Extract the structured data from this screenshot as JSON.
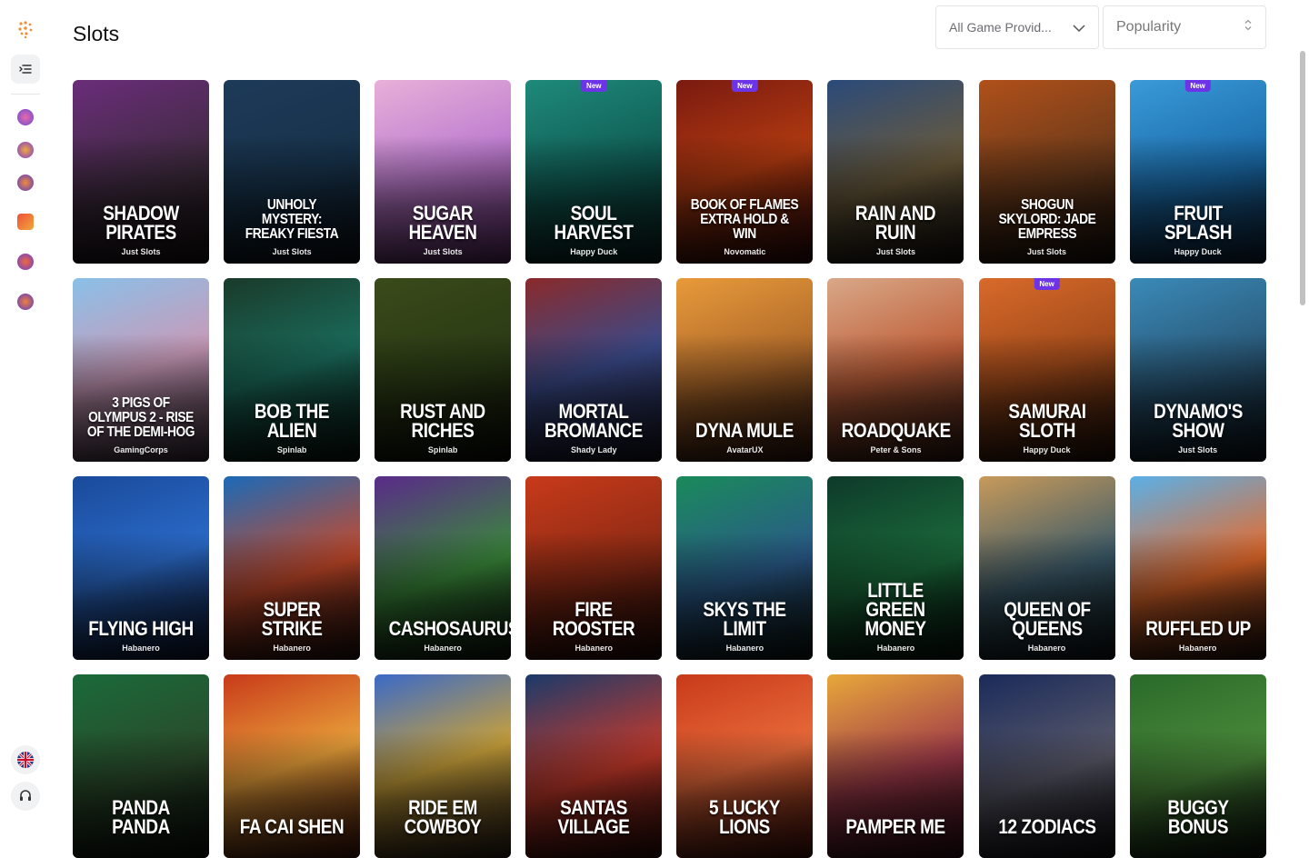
{
  "page": {
    "title": "Slots"
  },
  "filters": {
    "provider_label": "All Game Provid...",
    "sort_label": "Popularity"
  },
  "sidebar": {
    "icons": [
      "logo-icon",
      "menu-icon",
      "category-icon-1",
      "category-icon-2",
      "category-icon-3",
      "category-icon-4",
      "category-icon-5",
      "category-icon-6"
    ],
    "bottom": [
      "language-flag-icon",
      "support-headset-icon"
    ]
  },
  "games": [
    {
      "title": "Shadow Pirates",
      "provider": "Just Slots",
      "new": "",
      "bg": "linear-gradient(160deg,#6a2d7a,#3b2a3a 60%,#1d1418)"
    },
    {
      "title": "Unholy Mystery: Freaky Fiesta",
      "provider": "Just Slots",
      "new": "",
      "bg": "linear-gradient(160deg,#1d3a58,#17324a 55%,#0e1620)"
    },
    {
      "title": "Sugar Heaven",
      "provider": "Just Slots",
      "new": "",
      "bg": "linear-gradient(160deg,#e8b0d8,#c080d0 45%,#7a3a8a)"
    },
    {
      "title": "Soul Harvest",
      "provider": "Happy Duck",
      "new": "New",
      "bg": "linear-gradient(160deg,#1e8a7a,#0f5a52 55%,#0a2a28)"
    },
    {
      "title": "Book of Flames Extra Hold & Win",
      "provider": "Novomatic",
      "new": "New",
      "bg": "linear-gradient(160deg,#7a1a10,#b03a10 50%,#3a0a08)"
    },
    {
      "title": "Rain and Ruin",
      "provider": "Just Slots",
      "new": "",
      "bg": "linear-gradient(160deg,#2a4a7a,#6a5a3a 55%,#1a1410)"
    },
    {
      "title": "Shogun Skylord: Jade Empress",
      "provider": "Just Slots",
      "new": "",
      "bg": "linear-gradient(160deg,#b0501a,#6a3a1a 55%,#1e140e)"
    },
    {
      "title": "Fruit Splash",
      "provider": "Happy Duck",
      "new": "New",
      "bg": "linear-gradient(160deg,#3a9ad8,#1a6aa8 55%,#0e2a44)"
    },
    {
      "title": "3 Pigs of Olympus 2 - Rise of the Demi-Hog",
      "provider": "GamingCorps",
      "new": "",
      "bg": "linear-gradient(160deg,#8ac0e8,#c89ab8 50%,#4a3a4a)"
    },
    {
      "title": "Bob the Alien",
      "provider": "Spinlab",
      "new": "",
      "bg": "linear-gradient(160deg,#1a3a2a,#1a6a5a 50%,#0a1a14)"
    },
    {
      "title": "Rust and Riches",
      "provider": "Spinlab",
      "new": "",
      "bg": "linear-gradient(160deg,#3a4a1a,#2a3a14 55%,#0e1208)"
    },
    {
      "title": "Mortal Bromance",
      "provider": "Shady Lady",
      "new": "",
      "bg": "linear-gradient(160deg,#8a2a2a,#3a4a8a 50%,#1a1a2a)"
    },
    {
      "title": "Dyna Mule",
      "provider": "AvatarUX",
      "new": "",
      "bg": "linear-gradient(160deg,#e89a3a,#b06a2a 50%,#3a1a0e)"
    },
    {
      "title": "Roadquake",
      "provider": "Peter & Sons",
      "new": "",
      "bg": "linear-gradient(160deg,#d8a888,#c0603a 50%,#3a1e14)"
    },
    {
      "title": "Samurai Sloth",
      "provider": "Happy Duck",
      "new": "New",
      "bg": "linear-gradient(160deg,#d86a2a,#a04a1a 50%,#2a1408)"
    },
    {
      "title": "Dynamo's Show",
      "provider": "Just Slots",
      "new": "",
      "bg": "linear-gradient(160deg,#3a8ab8,#2a5a7a 50%,#0e1a24)"
    },
    {
      "title": "Flying High",
      "provider": "Habanero",
      "new": "",
      "bg": "linear-gradient(160deg,#1a4a9a,#2a6ac8 50%,#0e1a3a)"
    },
    {
      "title": "Super Strike",
      "provider": "Habanero",
      "new": "",
      "bg": "linear-gradient(160deg,#1a6ab8,#c84a2a 55%,#2a140e)"
    },
    {
      "title": "Cashosaurus",
      "provider": "Habanero",
      "new": "",
      "bg": "linear-gradient(160deg,#5a2a8a,#3a8a3a 55%,#0e1a0e)"
    },
    {
      "title": "Fire Rooster",
      "provider": "Habanero",
      "new": "",
      "bg": "linear-gradient(160deg,#c83a1a,#8a2a14 55%,#2a0e08)"
    },
    {
      "title": "Skys the Limit",
      "provider": "Habanero",
      "new": "",
      "bg": "linear-gradient(160deg,#1a8a5a,#2a5a8a 55%,#0e1a14)"
    },
    {
      "title": "Little Green Money",
      "provider": "Habanero",
      "new": "",
      "bg": "linear-gradient(160deg,#0e3a2a,#1a6a3a 55%,#081a10)"
    },
    {
      "title": "Queen of Queens",
      "provider": "Habanero",
      "new": "",
      "bg": "linear-gradient(160deg,#c89a5a,#3a5a6a 55%,#101a1e)"
    },
    {
      "title": "Ruffled Up",
      "provider": "Habanero",
      "new": "",
      "bg": "linear-gradient(160deg,#5ab0e8,#e86a2a 55%,#2a140a)"
    },
    {
      "title": "Panda Panda",
      "provider": "",
      "new": "",
      "bg": "linear-gradient(160deg,#1a6a3a,#2a4a2a 55%,#0e140e)"
    },
    {
      "title": "Fa Cai Shen",
      "provider": "",
      "new": "",
      "bg": "linear-gradient(160deg,#c83a1a,#e8a03a 50%,#5a1a0a)"
    },
    {
      "title": "Ride Em Cowboy",
      "provider": "",
      "new": "",
      "bg": "linear-gradient(160deg,#3a6ac8,#c8a03a 50%,#3a2a1a)"
    },
    {
      "title": "Santas Village",
      "provider": "",
      "new": "",
      "bg": "linear-gradient(160deg,#1a3a6a,#c83a2a 55%,#3a0e0a)"
    },
    {
      "title": "5 Lucky Lions",
      "provider": "",
      "new": "",
      "bg": "linear-gradient(160deg,#c83a1a,#e86a3a 50%,#5a140a)"
    },
    {
      "title": "Pamper Me",
      "provider": "",
      "new": "",
      "bg": "linear-gradient(160deg,#e8a83a,#a03a4a 55%,#3a0e1a)"
    },
    {
      "title": "12 Zodiacs",
      "provider": "",
      "new": "",
      "bg": "linear-gradient(160deg,#1a2a5a,#5a5a6a 55%,#14141a)"
    },
    {
      "title": "Buggy Bonus",
      "provider": "",
      "new": "",
      "bg": "linear-gradient(160deg,#2a6a2a,#4a8a3a 55%,#0e1a0e)"
    }
  ]
}
